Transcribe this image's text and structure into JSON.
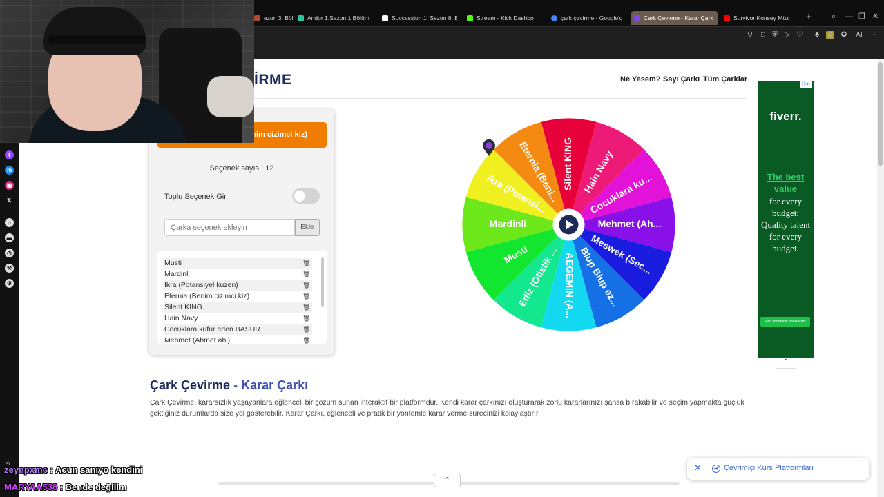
{
  "browser": {
    "tabs": [
      {
        "label": "ezon 3. Bölü",
        "favicon_color": "#b04a2d"
      },
      {
        "label": "Andor 1.Sezon 1.Bölüm -",
        "favicon_color": "#2ec4a0"
      },
      {
        "label": "Succession 1. Sezon 8. B",
        "favicon_color": "#ffffff"
      },
      {
        "label": "Stream - Kick Dashbo",
        "favicon_color": "#53fc18"
      },
      {
        "label": "çark çevirme - Google'd",
        "favicon_color": "#4285f4"
      },
      {
        "label": "Çark Çevirme - Karar Çark",
        "favicon_color": "#7a4bd8"
      },
      {
        "label": "Survivor Konsey Müz",
        "favicon_color": "#ff0000"
      }
    ],
    "new_tab": "+",
    "window_controls": [
      "⌕",
      "—",
      "❐",
      "✕"
    ]
  },
  "page": {
    "logo": "İRME",
    "nav": [
      "Ne Yesem?",
      "Sayı Çarkı",
      "Tüm Çarklar"
    ],
    "result_button": "nim cizimci kiz)",
    "option_count": "Seçenek sayısı: 12",
    "bulk_label": "Toplu Seçenek Gir",
    "input_placeholder": "Çarka seçenek ekleyin",
    "add_button": "Ekle",
    "options": [
      "Musti",
      "Mardinli",
      "Ikra (Potansiyel kuzen)",
      "Eternia (Benim cizimci kiz)",
      "Silent KING",
      "Hain Navy",
      "Cocuklara kufur eden BASUR",
      "Mehmet (Ahmet abi)"
    ],
    "wheel": {
      "play_icon": "play-icon",
      "segments": [
        {
          "label": "Silent KING",
          "color": "#e8003a"
        },
        {
          "label": "Hain Navy",
          "color": "#ee1a78"
        },
        {
          "label": "Cocuklara ku...",
          "color": "#e312d8"
        },
        {
          "label": "Mehmet (Ah...",
          "color": "#8a10ea"
        },
        {
          "label": "Meswek (Sec...",
          "color": "#1a1ce0"
        },
        {
          "label": "Blup Blup ez...",
          "color": "#1570e6"
        },
        {
          "label": "AEGEMIN (A...",
          "color": "#13d9f0"
        },
        {
          "label": "Ediz (Otistik ...",
          "color": "#14e88f"
        },
        {
          "label": "Musti",
          "color": "#12e62e"
        },
        {
          "label": "Mardinli",
          "color": "#6de81a"
        },
        {
          "label": "Ikra (Potansi...",
          "color": "#f0f020"
        },
        {
          "label": "Eternia (Beni...",
          "color": "#f58a13"
        }
      ]
    },
    "heading": "Çark Çevirme",
    "heading_sep": " - ",
    "heading_accent": "Karar Çarkı",
    "description": "Çark Çevirme, kararsızlık yaşayanlara eğlenceli bir çözüm sunan interaktif bir platformdur. Kendi karar çarkınızı oluşturarak zorlu kararlarınızı şansa bırakabilir ve seçim yapmakta güçlük çektiğiniz durumlarda size yol gösterebilir. Karar Çarkı, eğlenceli ve pratik bir yöntemle karar verme sürecinizi kolaylaştırır."
  },
  "ad": {
    "brand": "fiverr.",
    "headline": "The best value",
    "body": "for every budget: Quality talent for every budget.",
    "cta": "Find affordable freelancers",
    "collapse": "⌃"
  },
  "toast": {
    "close": "✕",
    "label": "Çevrimiçi Kurs Platformları"
  },
  "scroll_up": "⌃",
  "chat": [
    {
      "user": "zeynpxmc",
      "message": ": Acun sanıyo kendini"
    },
    {
      "user": "MARYAA538",
      "message": ": Bende değilim"
    }
  ]
}
